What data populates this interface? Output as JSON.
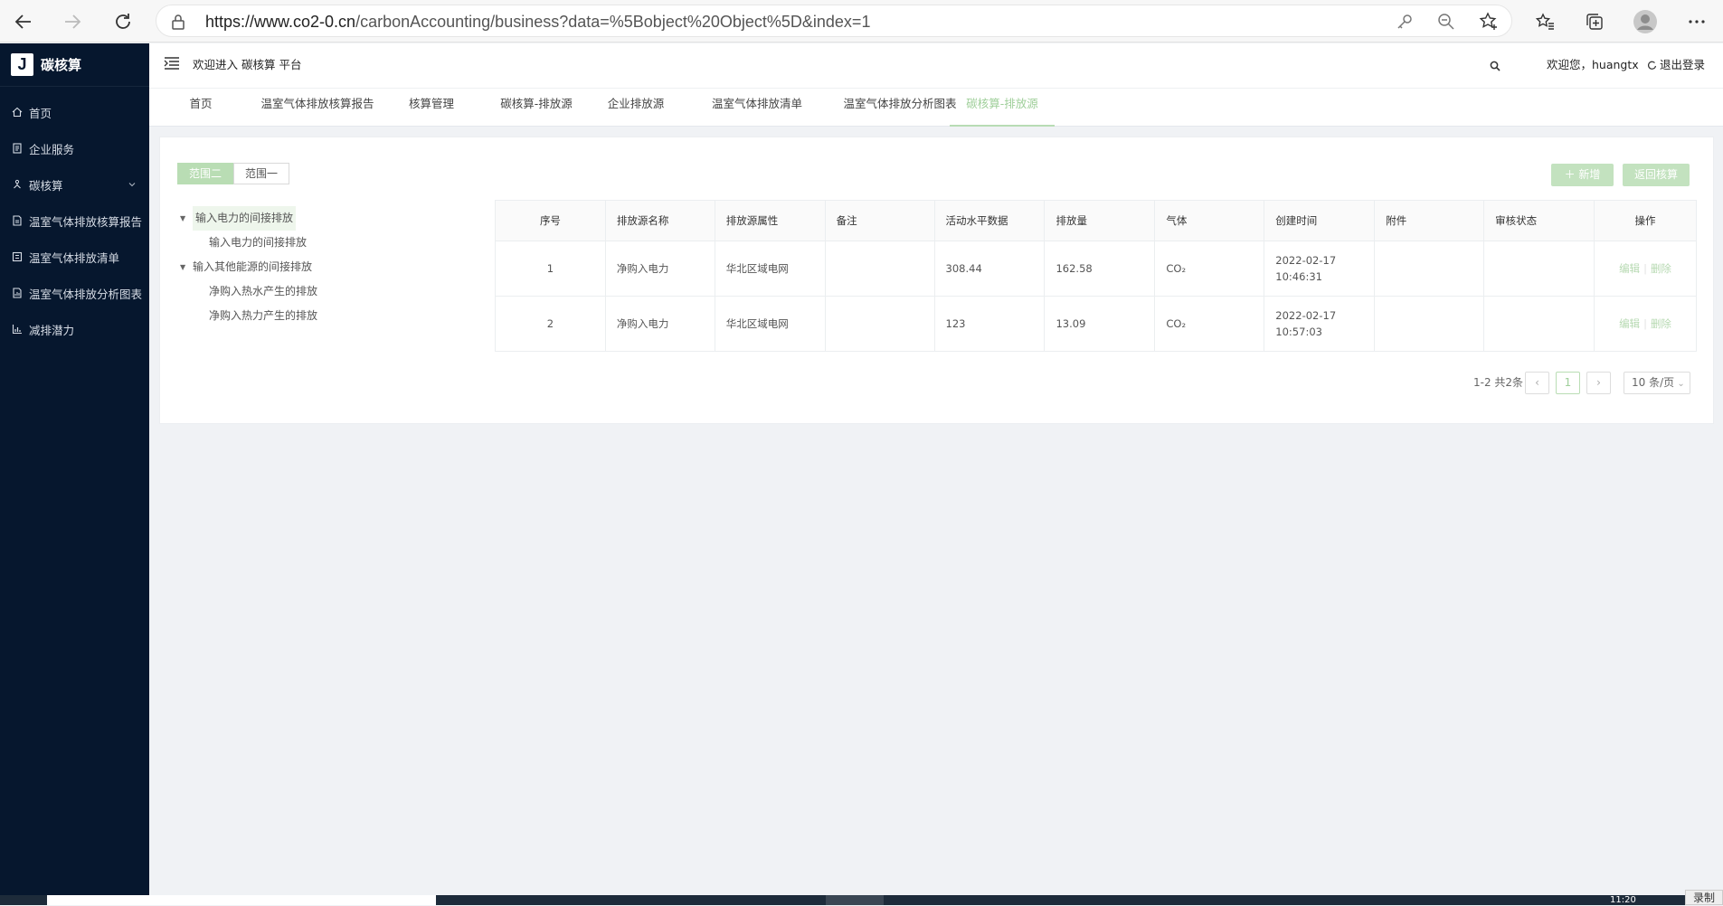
{
  "browser": {
    "url_host": "https://www.co2-0.cn",
    "url_path": "/carbonAccounting/business?data=%5Bobject%20Object%5D&index=1"
  },
  "sidebar": {
    "logo_letter": "J",
    "logo_text": "碳核算",
    "items": [
      {
        "label": "首页",
        "icon": "home-icon"
      },
      {
        "label": "企业服务",
        "icon": "document-icon"
      },
      {
        "label": "碳核算",
        "icon": "network-icon"
      },
      {
        "label": "温室气体排放核算报告",
        "icon": "report-icon"
      },
      {
        "label": "温室气体排放清单",
        "icon": "list-icon"
      },
      {
        "label": "温室气体排放分析图表",
        "icon": "chart-doc-icon"
      },
      {
        "label": "减排潜力",
        "icon": "bar-chart-icon"
      }
    ]
  },
  "header": {
    "welcome": "欢迎进入 碳核算 平台",
    "user": "欢迎您，huangtx",
    "logout": "退出登录"
  },
  "tabs": [
    {
      "label": "首页"
    },
    {
      "label": "温室气体排放核算报告"
    },
    {
      "label": "核算管理"
    },
    {
      "label": "碳核算-排放源"
    },
    {
      "label": "企业排放源"
    },
    {
      "label": "温室气体排放清单"
    },
    {
      "label": "温室气体排放分析图表"
    },
    {
      "label": "碳核算-排放源"
    }
  ],
  "scope": {
    "scope2": "范围二",
    "scope1": "范围一"
  },
  "actions": {
    "add": "新增",
    "return": "返回核算"
  },
  "tree": {
    "group1": "输入电力的间接排放",
    "group1_child": "输入电力的间接排放",
    "group2": "输入其他能源的间接排放",
    "group2_child1": "净购入热水产生的排放",
    "group2_child2": "净购入热力产生的排放"
  },
  "table": {
    "headers": [
      "序号",
      "排放源名称",
      "排放源属性",
      "备注",
      "活动水平数据",
      "排放量",
      "气体",
      "创建时间",
      "附件",
      "审核状态",
      "操作"
    ],
    "rows": [
      {
        "no": "1",
        "name": "净购入电力",
        "attr": "华北区域电网",
        "note": "",
        "activity": "308.44",
        "emission": "162.58",
        "gas": "CO₂",
        "date": "2022-02-17",
        "time": "10:46:31",
        "attachment": "",
        "status": "",
        "edit": "编辑",
        "del": "删除"
      },
      {
        "no": "2",
        "name": "净购入电力",
        "attr": "华北区域电网",
        "note": "",
        "activity": "123",
        "emission": "13.09",
        "gas": "CO₂",
        "date": "2022-02-17",
        "time": "10:57:03",
        "attachment": "",
        "status": "",
        "edit": "编辑",
        "del": "删除"
      }
    ]
  },
  "pagination": {
    "summary": "1-2 共2条",
    "page": "1",
    "page_size": "10 条/页"
  },
  "taskbar": {
    "time": "11:20",
    "record": "录制"
  }
}
